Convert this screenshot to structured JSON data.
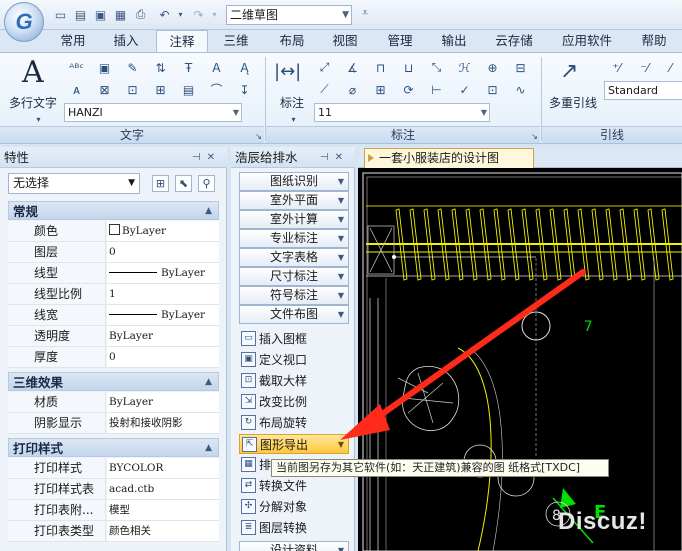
{
  "quick_access": {
    "document_title": "二维草图",
    "logo_letter": "G"
  },
  "ribbon_tabs": [
    "常用",
    "插入",
    "注释",
    "三维",
    "布局",
    "视图",
    "管理",
    "输出",
    "云存储",
    "应用软件",
    "帮助"
  ],
  "active_tab": "注释",
  "ribbon": {
    "text_group": {
      "label": "文字",
      "big_button": "多行文字",
      "big_glyph": "A",
      "font_select": "HANZI"
    },
    "dim_group": {
      "label": "标注",
      "big_button": "标注",
      "size_select": "11"
    },
    "leader_group": {
      "label": "引线",
      "big_button": "多重引线",
      "style_select": "Standard"
    }
  },
  "properties_panel": {
    "title": "特性",
    "selection": "无选择",
    "sections": [
      {
        "name": "常规",
        "rows": [
          {
            "key": "颜色",
            "value": "ByLayer",
            "kind": "swatch"
          },
          {
            "key": "图层",
            "value": "0",
            "kind": "text"
          },
          {
            "key": "线型",
            "value": "ByLayer",
            "kind": "line"
          },
          {
            "key": "线型比例",
            "value": "1",
            "kind": "text"
          },
          {
            "key": "线宽",
            "value": "ByLayer",
            "kind": "line"
          },
          {
            "key": "透明度",
            "value": "ByLayer",
            "kind": "text"
          },
          {
            "key": "厚度",
            "value": "0",
            "kind": "text"
          }
        ]
      },
      {
        "name": "三维效果",
        "rows": [
          {
            "key": "材质",
            "value": "ByLayer",
            "kind": "text"
          },
          {
            "key": "阴影显示",
            "value": "投射和接收阴影",
            "kind": "text"
          }
        ]
      },
      {
        "name": "打印样式",
        "rows": [
          {
            "key": "打印样式",
            "value": "BYCOLOR",
            "kind": "text"
          },
          {
            "key": "打印样式表",
            "value": "acad.ctb",
            "kind": "text"
          },
          {
            "key": "打印表附...",
            "value": "模型",
            "kind": "text"
          },
          {
            "key": "打印表类型",
            "value": "颜色相关",
            "kind": "text"
          }
        ]
      }
    ]
  },
  "tool_panel": {
    "title": "浩辰给排水",
    "categories": [
      "图纸识别",
      "室外平面",
      "室外计算",
      "专业标注",
      "文字表格",
      "尺寸标注",
      "符号标注",
      "文件布图"
    ],
    "items": [
      {
        "label": "插入图框",
        "icon": "frame-icon"
      },
      {
        "label": "定义视口",
        "icon": "viewport-icon"
      },
      {
        "label": "截取大样",
        "icon": "detail-icon"
      },
      {
        "label": "改变比例",
        "icon": "scale-icon"
      },
      {
        "label": "布局旋转",
        "icon": "rotate-icon"
      },
      {
        "label": "图形导出",
        "icon": "export-icon",
        "highlighted": true
      },
      {
        "label": "排图工具",
        "icon": "arrange-icon"
      },
      {
        "label": "转换文件",
        "icon": "convert-icon"
      },
      {
        "label": "分解对象",
        "icon": "explode-icon"
      },
      {
        "label": "图层转换",
        "icon": "layer-icon"
      }
    ],
    "bottom_category": "设计资料"
  },
  "drawing": {
    "tab_title": "一套小服装店的设计图",
    "label_7": "7",
    "label_8": "8",
    "label_E": "E"
  },
  "tooltip": "当前图另存为其它软件(如：天正建筑)兼容的图  纸格式[TXDC]",
  "watermark": "Discuz!",
  "colors": {
    "highlight": "#ffc83c",
    "arrow": "#ff2a1a",
    "cad_yellow": "#f2f200",
    "cad_green": "#00e000"
  }
}
